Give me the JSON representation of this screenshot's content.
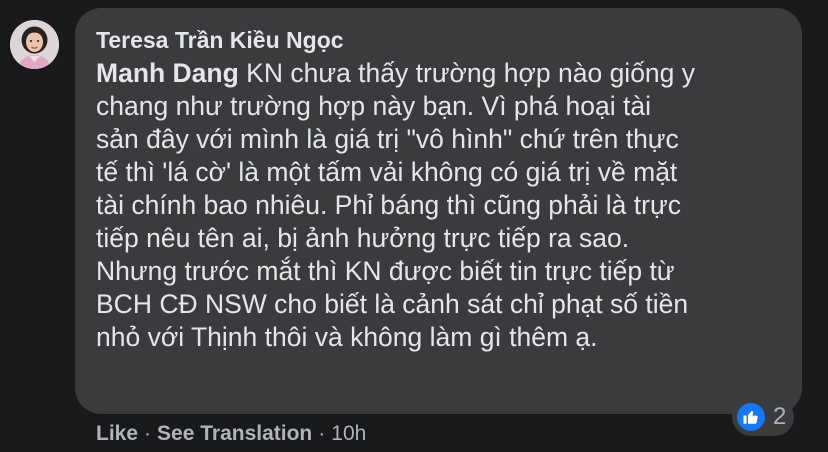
{
  "comment": {
    "author": "Teresa Trần Kiều Ngọc",
    "mention": "Manh Dang",
    "lines": [
      " KN chưa thấy trường hợp nào giống y",
      "chang như trường hợp này bạn. Vì phá hoại tài",
      "sản đây với mình là giá trị \"vô hình\" chứ trên thực",
      "tế thì 'lá cờ' là một tấm vải không có giá trị về mặt",
      "tài chính bao nhiêu. Phỉ báng thì cũng phải là trực",
      "tiếp nêu tên ai, bị ảnh hưởng trực tiếp ra sao.",
      "Nhưng trước mắt thì KN được biết tin trực tiếp từ",
      "BCH CĐ NSW cho biết là cảnh sát chỉ phạt số tiền",
      "nhỏ với Thịnh thôi và không làm gì thêm ạ."
    ]
  },
  "reactions": {
    "icon": "like-icon",
    "count": "2",
    "color": "#1877f2"
  },
  "actions": {
    "like": "Like",
    "separator": "·",
    "see_translation": "See Translation",
    "time": "10h"
  }
}
